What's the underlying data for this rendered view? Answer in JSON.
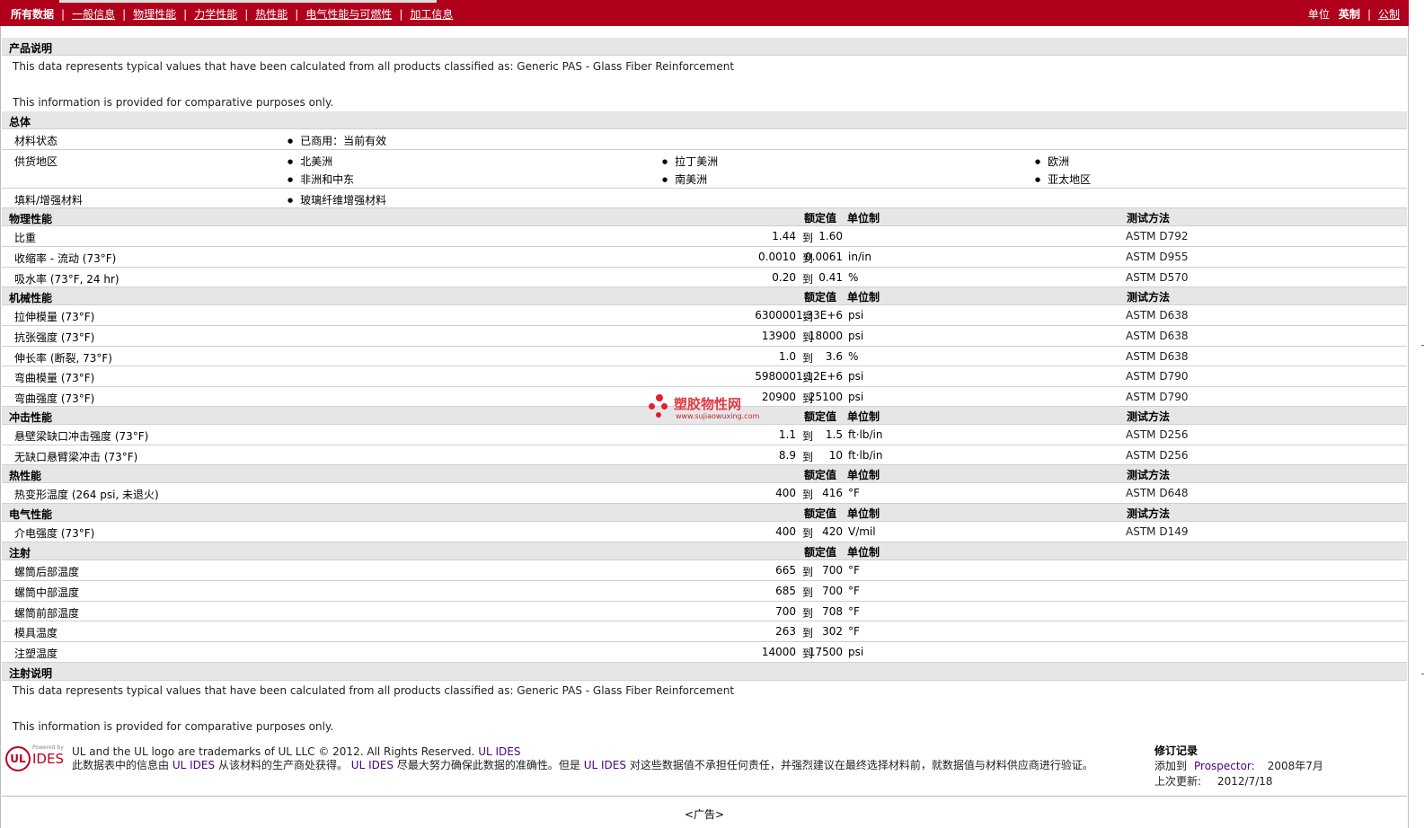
{
  "nav": {
    "tabs": [
      "所有数据",
      "一般信息",
      "物理性能",
      "力学性能",
      "热性能",
      "电气性能与可燃性",
      "加工信息"
    ],
    "units_label": "单位",
    "unit_active": "英制",
    "unit_other": "公制"
  },
  "desc": {
    "title": "产品说明",
    "line1": "This data represents typical values that have been calculated from all products classified as: Generic PAS - Glass Fiber Reinforcement",
    "line2": "This information is provided for comparative purposes only."
  },
  "general": {
    "title": "总体",
    "status_label": "材料状态",
    "status": "已商用：当前有效",
    "regions_label": "供货地区",
    "regions": [
      "北美洲",
      "拉丁美洲",
      "欧洲",
      "非洲和中东",
      "南美洲",
      "亚太地区"
    ],
    "filler_label": "填料/增强材料",
    "filler": "玻璃纤维增强材料"
  },
  "headers": {
    "nominal": "额定值",
    "unit": "单位制",
    "method": "测试方法",
    "to": "到"
  },
  "physical": {
    "title": "物理性能",
    "rows": [
      {
        "name": "比重",
        "v1": "1.44",
        "v2": "1.60",
        "unit": "",
        "method": "ASTM D792"
      },
      {
        "name": "收缩率 - 流动 (73°F)",
        "v1": "0.0010",
        "v2": "0.0061",
        "unit": "in/in",
        "method": "ASTM D955"
      },
      {
        "name": "吸水率 (73°F, 24 hr)",
        "v1": "0.20",
        "v2": "0.41",
        "unit": "%",
        "method": "ASTM D570"
      }
    ]
  },
  "mechanical": {
    "title": "机械性能",
    "rows": [
      {
        "name": "拉伸模量 (73°F)",
        "v1": "630000",
        "v2": "1.33E+6",
        "unit": "psi",
        "method": "ASTM D638"
      },
      {
        "name": "抗张强度 (73°F)",
        "v1": "13900",
        "v2": "18000",
        "unit": "psi",
        "method": "ASTM D638"
      },
      {
        "name": "伸长率 (断裂, 73°F)",
        "v1": "1.0",
        "v2": "3.6",
        "unit": "%",
        "method": "ASTM D638"
      },
      {
        "name": "弯曲模量 (73°F)",
        "v1": "598000",
        "v2": "1.12E+6",
        "unit": "psi",
        "method": "ASTM D790"
      },
      {
        "name": "弯曲强度 (73°F)",
        "v1": "20900",
        "v2": "25100",
        "unit": "psi",
        "method": "ASTM D790"
      }
    ]
  },
  "impact": {
    "title": "冲击性能",
    "rows": [
      {
        "name": "悬壁梁缺口冲击强度 (73°F)",
        "v1": "1.1",
        "v2": "1.5",
        "unit": "ft·lb/in",
        "method": "ASTM D256"
      },
      {
        "name": "无缺口悬臂梁冲击 (73°F)",
        "v1": "8.9",
        "v2": "10",
        "unit": "ft·lb/in",
        "method": "ASTM D256"
      }
    ]
  },
  "thermal": {
    "title": "热性能",
    "rows": [
      {
        "name": "热变形温度 (264 psi, 未退火)",
        "v1": "400",
        "v2": "416",
        "unit": "°F",
        "method": "ASTM D648"
      }
    ]
  },
  "electrical": {
    "title": "电气性能",
    "rows": [
      {
        "name": "介电强度 (73°F)",
        "v1": "400",
        "v2": "420",
        "unit": "V/mil",
        "method": "ASTM D149"
      }
    ]
  },
  "injection": {
    "title": "注射",
    "rows": [
      {
        "name": "螺筒后部温度",
        "v1": "665",
        "v2": "700",
        "unit": "°F"
      },
      {
        "name": "螺筒中部温度",
        "v1": "685",
        "v2": "700",
        "unit": "°F"
      },
      {
        "name": "螺筒前部温度",
        "v1": "700",
        "v2": "708",
        "unit": "°F"
      },
      {
        "name": "模具温度",
        "v1": "263",
        "v2": "302",
        "unit": "°F"
      },
      {
        "name": "注塑温度",
        "v1": "14000",
        "v2": "17500",
        "unit": "psi"
      }
    ]
  },
  "injection_notes": {
    "title": "注射说明",
    "line1": "This data represents typical values that have been calculated from all products classified as: Generic PAS - Glass Fiber Reinforcement",
    "line2": "This information is provided for comparative purposes only."
  },
  "watermark": {
    "name": "塑胶物性网",
    "url": "www.sujiaowuxing.com"
  },
  "footer": {
    "powered_by": "Powered by",
    "ides": "IDES",
    "ul": "UL",
    "trademark": "UL and the UL logo are trademarks of UL LLC © 2012. All Rights Reserved.",
    "ul_ides": "UL IDES",
    "disclaimer_a": "此数据表中的信息由",
    "disclaimer_b": "从该材料的生产商处获得。",
    "disclaimer_c": "尽最大努力确保此数据的准确性。但是",
    "disclaimer_d": "对这些数据值不承担任何责任，并强烈建议在最终选择材料前，就数据值与材料供应商进行验证。",
    "rev_title": "修订记录",
    "added_label": "添加到",
    "added_to": "Prospector:",
    "added_date": "2008年7月",
    "updated_label": "上次更新:",
    "updated_date": "2012/7/18"
  },
  "ad": "<广告>"
}
